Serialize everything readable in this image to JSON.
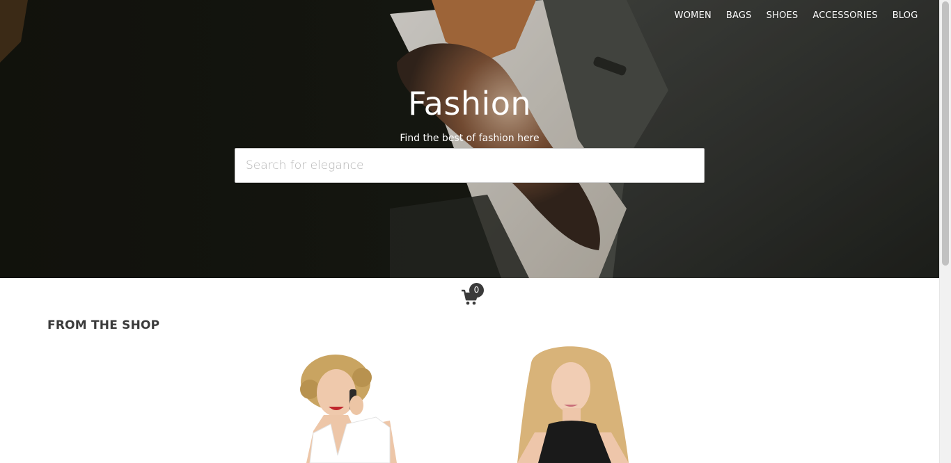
{
  "nav": {
    "items": [
      "WOMEN",
      "BAGS",
      "SHOES",
      "ACCESSORIES",
      "BLOG"
    ]
  },
  "hero": {
    "title": "Fashion",
    "subtitle": "Find the best of fashion here"
  },
  "search": {
    "placeholder": "Search for elegance",
    "value": ""
  },
  "cart": {
    "count": "0",
    "icon": "shopping-cart-icon"
  },
  "shop": {
    "title": "FROM THE SHOP",
    "products": [
      {
        "image": "woman-white-top-on-phone"
      },
      {
        "image": "woman-black-top"
      }
    ]
  },
  "colors": {
    "hero_bg": "#1c1e18",
    "text_dark": "#3b3b3b",
    "badge": "#3a3a3a"
  }
}
